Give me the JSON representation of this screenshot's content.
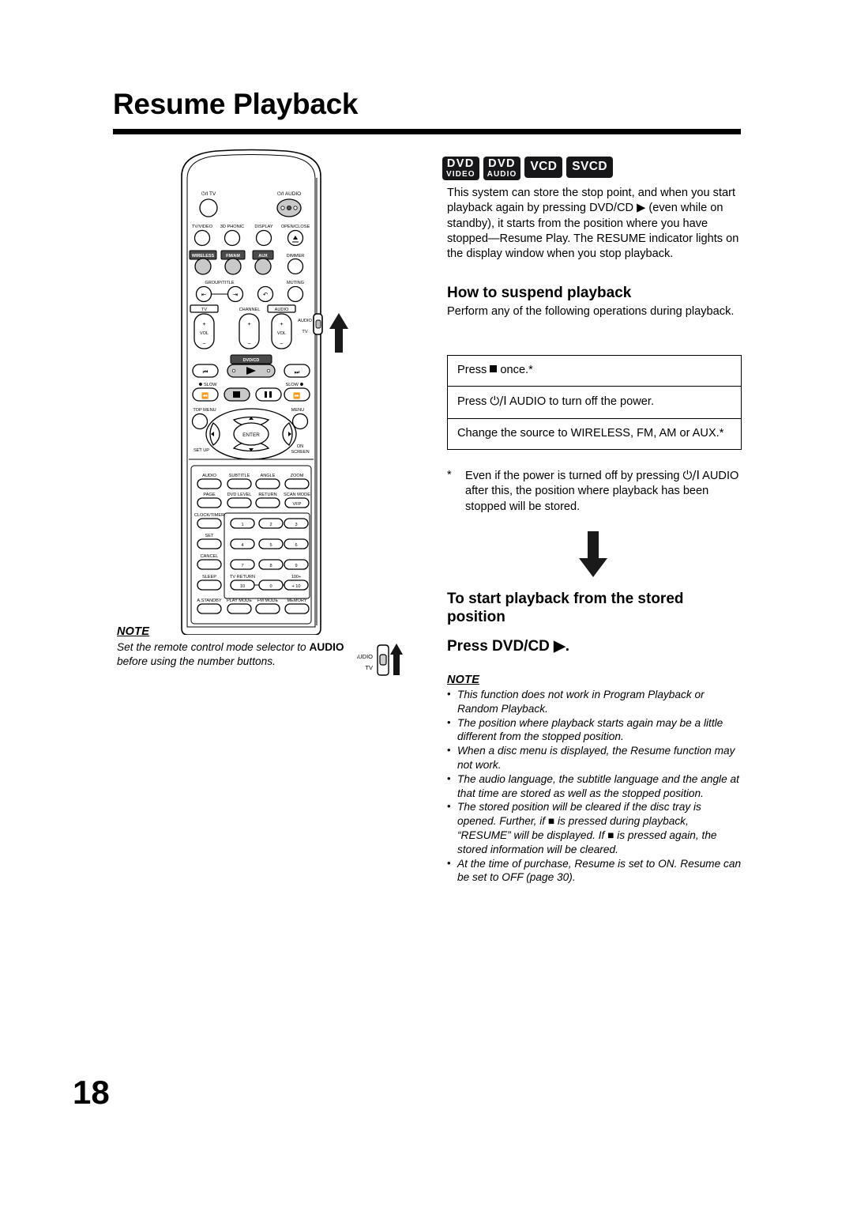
{
  "page": {
    "title": "Resume Playback",
    "number": "18"
  },
  "disc_badges": [
    {
      "name": "dvd-video-badge",
      "line1": "DVD",
      "line2": "VIDEO"
    },
    {
      "name": "dvd-audio-badge",
      "line1": "DVD",
      "line2": "AUDIO"
    },
    {
      "name": "vcd-badge",
      "line1": "VCD",
      "line2": ""
    },
    {
      "name": "svcd-badge",
      "line1": "SVCD",
      "line2": ""
    }
  ],
  "intro": {
    "paragraph": "This system can store the stop point, and when you start playback again by pressing DVD/CD ▶ (even while on standby), it starts from the position where you have stopped—Resume Play. The RESUME indicator lights on the display window when you stop playback."
  },
  "suspend": {
    "heading": "How to suspend playback",
    "lead": "Perform any of the following operations during playback.",
    "rows": [
      {
        "pre": "Press ",
        "symbol": "stop-square",
        "post": " once.*"
      },
      {
        "pre": "Press ",
        "symbol": "power-standby",
        "post": " AUDIO to turn off the power."
      },
      {
        "pre": "Change the source to WIRELESS, FM, AM or AUX.*",
        "symbol": "",
        "post": ""
      }
    ],
    "footnote_marker": "*",
    "footnote_pre": "Even if the power is turned off by pressing ",
    "footnote_symbol": "power-standby",
    "footnote_post": " AUDIO after this, the position where playback has been stopped will be stored."
  },
  "start": {
    "heading": "To start playback from the stored position",
    "instruction_pre": "Press DVD/CD ",
    "instruction_symbol": "▶",
    "instruction_post": ".",
    "note_label": "NOTE",
    "notes": [
      "This function does not work in Program Playback or Random Playback.",
      "The position where playback starts again may be a little different from the stopped position.",
      "When a disc menu is displayed, the Resume function may not work.",
      "The audio language, the subtitle language and the angle at that time are stored as well as the stopped position.",
      "The stored position will be cleared if the disc tray is opened. Further, if ■ is pressed during playback, “RESUME” will be displayed. If ■ is pressed again, the stored information will be cleared.",
      "At the time of purchase, Resume is set to ON. Resume can be set to OFF (page 30)."
    ]
  },
  "left_note": {
    "label": "NOTE",
    "text_pre": "Set the remote control mode selector to ",
    "text_bold": "AUDIO",
    "text_post": " before using the number buttons."
  },
  "mode_selector": {
    "top_label": "AUDIO",
    "bottom_label": "TV"
  },
  "remote": {
    "power_tv": "⏻/I TV",
    "power_audio": "⏻/I AUDIO",
    "row_tvvideo": [
      "TV/VIDEO",
      "3D PHONIC",
      "DISPLAY",
      "OPEN/CLOSE"
    ],
    "row_source": [
      "WIRELESS",
      "FM/AM",
      "AUX",
      "DIMMER"
    ],
    "group_title": "GROUP/TITLE",
    "muting": "MUTING",
    "vol_tv": "TV",
    "vol_tv_sub": "VOL",
    "channel": "CHANNEL",
    "vol_audio": "AUDIO",
    "vol_audio_sub": "VOL",
    "side_audio": "AUDIO",
    "side_tv": "TV",
    "dvdcd": "DVD/CD",
    "slow_left": "SLOW",
    "slow_right": "SLOW",
    "top_menu": "TOP MENU",
    "menu": "MENU",
    "enter": "ENTER",
    "set_up": "SET UP",
    "on_screen_1": "ON",
    "on_screen_2": "SCREEN",
    "pad_row1": [
      "AUDIO",
      "SUBTITLE",
      "ANGLE",
      "ZOOM"
    ],
    "pad_row2": [
      "PAGE",
      "DVD LEVEL",
      "RETURN",
      "SCAN MODE"
    ],
    "vfp": "VFP",
    "left_col": [
      "CLOCK/TIMER",
      "SET",
      "CANCEL",
      "SLEEP"
    ],
    "numbers": [
      "1",
      "2",
      "3",
      "4",
      "5",
      "6",
      "7",
      "8",
      "9"
    ],
    "tv_return": "TV RETURN",
    "hundred_plus": "100+",
    "num_10": "10",
    "num_0": "0",
    "num_plus10": "+10",
    "bottom_row": [
      "A.STANDBY",
      "PLAY MODE",
      "FM MODE",
      "MEMORY"
    ]
  }
}
